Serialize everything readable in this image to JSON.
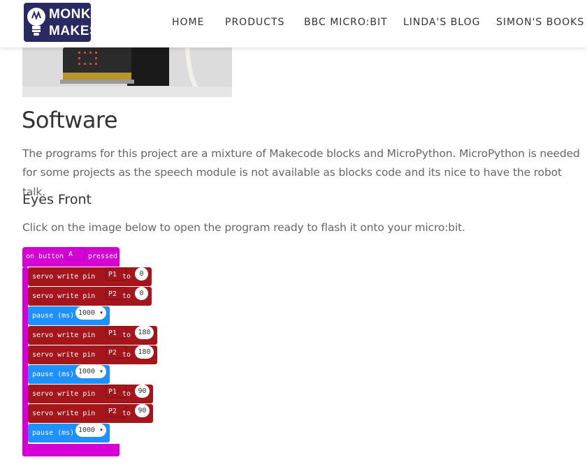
{
  "brand": {
    "logo_line1": "MONK",
    "logo_line2": "MAKES"
  },
  "nav": {
    "items": [
      "HOME",
      "PRODUCTS",
      "BBC MICRO:BIT",
      "LINDA'S BLOG",
      "SIMON'S BOOKS"
    ]
  },
  "content": {
    "heading": "Software",
    "intro_line1": "The programs for this project are a mixture of Makecode blocks and MicroPython. MicroPython is needed",
    "intro_line2": "for some projects as the speech module is not available as blocks code and its nice to have the robot talk.",
    "subheading": "Eyes Front",
    "instruction": "Click on the image below to open the program ready to flash it onto your micro:bit."
  },
  "program": {
    "event": {
      "prefix": "on button",
      "button": "A",
      "suffix": "pressed"
    },
    "blocks": [
      {
        "type": "servo",
        "label": "servo write pin",
        "pin": "P1",
        "to": "to",
        "value": "0"
      },
      {
        "type": "servo",
        "label": "servo write pin",
        "pin": "P2",
        "to": "to",
        "value": "0"
      },
      {
        "type": "pause",
        "label": "pause (ms)",
        "value": "1000 ▾"
      },
      {
        "type": "servo",
        "label": "servo write pin",
        "pin": "P1",
        "to": "to",
        "value": "180"
      },
      {
        "type": "servo",
        "label": "servo write pin",
        "pin": "P2",
        "to": "to",
        "value": "180"
      },
      {
        "type": "pause",
        "label": "pause (ms)",
        "value": "1000 ▾"
      },
      {
        "type": "servo",
        "label": "servo write pin",
        "pin": "P1",
        "to": "to",
        "value": "90"
      },
      {
        "type": "servo",
        "label": "servo write pin",
        "pin": "P2",
        "to": "to",
        "value": "90"
      },
      {
        "type": "pause",
        "label": "pause (ms)",
        "value": "1000 ▾"
      }
    ]
  },
  "colors": {
    "event_block": "#d400d4",
    "servo_block": "#a4161c",
    "pause_block": "#1e90ff",
    "logo_bg": "#2a2a63"
  }
}
